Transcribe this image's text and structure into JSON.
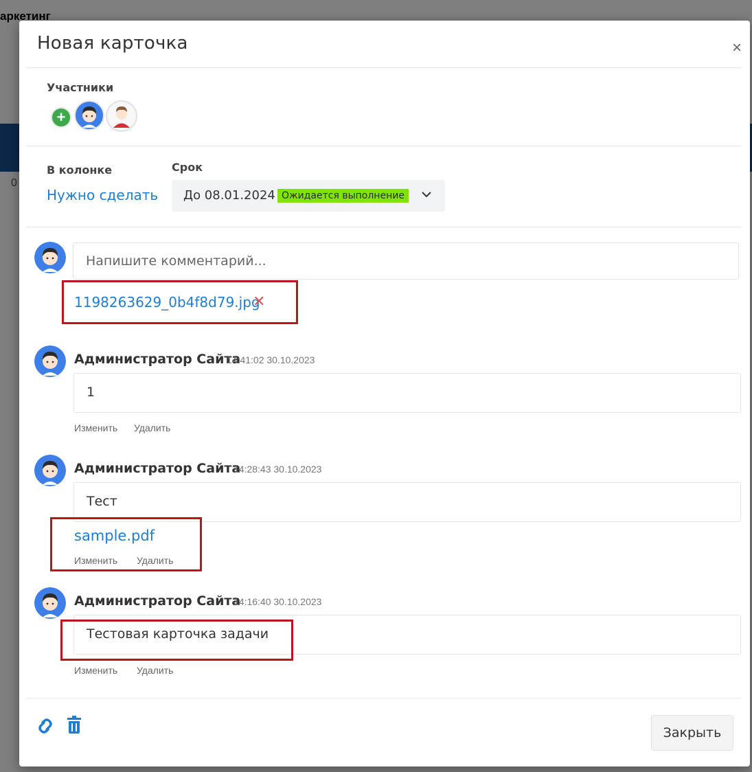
{
  "background": {
    "header_text": "аркетинг",
    "zero": "0"
  },
  "modal": {
    "title": "Новая карточка",
    "close_symbol": "×"
  },
  "participants": {
    "label": "Участники",
    "add_symbol": "+"
  },
  "column": {
    "label": "В колонке",
    "value": "Нужно сделать"
  },
  "deadline": {
    "label": "Срок",
    "date": "До 08.01.2024",
    "status": "Ожидается выполнение"
  },
  "comment_form": {
    "placeholder": "Напишите комментарий...",
    "attachment": "1198263629_0b4f8d79.jpg",
    "remove_symbol": "✕"
  },
  "comments": [
    {
      "author": "Администратор Сайта",
      "time": "14:41:02 30.10.2023",
      "text": "1",
      "edit": "Изменить",
      "delete": "Удалить"
    },
    {
      "author": "Администратор Сайта",
      "time": "14:28:43 30.10.2023",
      "text": "Тест",
      "file": "sample.pdf",
      "edit": "Изменить",
      "delete": "Удалить"
    },
    {
      "author": "Администратор Сайта",
      "time": "14:16:40 30.10.2023",
      "text": "Тестовая карточка задачи",
      "edit": "Изменить",
      "delete": "Удалить"
    }
  ],
  "footer": {
    "close_label": "Закрыть"
  },
  "colors": {
    "link": "#1f7ed0",
    "badge": "#7ee400",
    "add": "#3caa4a",
    "avatar": "#3d7ee8",
    "highlight": "#c0141c"
  },
  "icons": [
    "plus-icon",
    "user-avatar-icon",
    "chevron-down-icon",
    "link-icon",
    "trash-icon",
    "close-icon"
  ]
}
